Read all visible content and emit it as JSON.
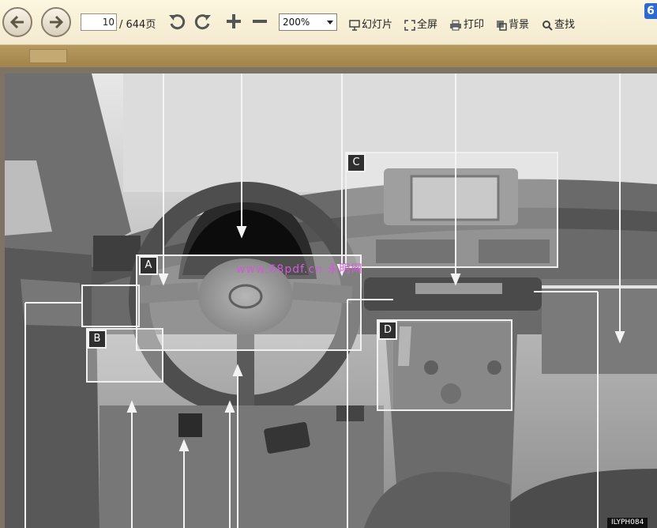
{
  "toolbar": {
    "current_page": "10",
    "total_pages": "/ 644页",
    "zoom": "200%",
    "slideshow": "幻灯片",
    "fullscreen": "全屏",
    "print": "打印",
    "background": "背景",
    "find": "查找",
    "corner_glyph": "6"
  },
  "document": {
    "callouts": [
      "A",
      "B",
      "C",
      "D"
    ],
    "watermark": "www.68pdf.cn 永明网",
    "figure_code": "ILYPH084"
  }
}
